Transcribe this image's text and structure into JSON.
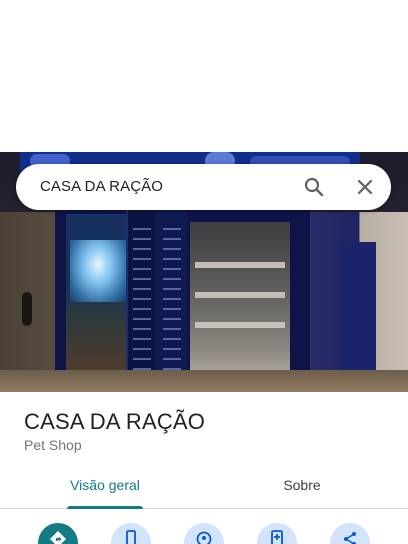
{
  "search": {
    "query": "CASA DA RAÇÃO"
  },
  "place": {
    "name": "CASA DA RAÇÃO",
    "category": "Pet Shop"
  },
  "tabs": [
    {
      "label": "Visão geral",
      "active": true
    },
    {
      "label": "Sobre",
      "active": false
    }
  ],
  "actions": [
    {
      "icon": "directions-icon",
      "primary": true
    },
    {
      "icon": "phone-icon"
    },
    {
      "icon": "location-icon"
    },
    {
      "icon": "save-icon"
    },
    {
      "icon": "share-icon"
    }
  ],
  "colors": {
    "accent": "#137b83",
    "action_bg": "#d2e3fc",
    "text_primary": "#202124",
    "text_secondary": "#70757a"
  }
}
